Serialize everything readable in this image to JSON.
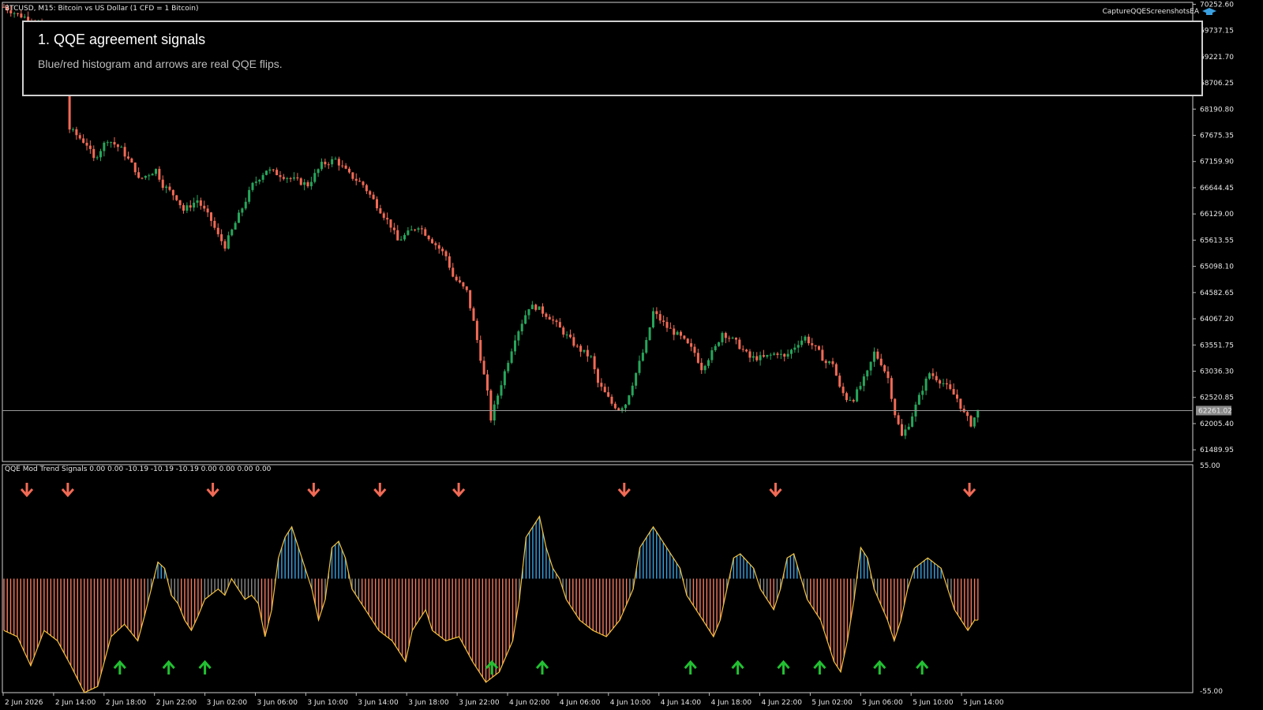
{
  "window": {
    "symbol_title": "BTCUSD, M15:  Bitcoin vs US Dollar (1 CFD = 1 Bitcoin)",
    "ea_label": "CaptureQQEScreenshotsEA",
    "ea_icon": "graduation-cap-icon"
  },
  "info_box": {
    "title": "1. QQE agreement signals",
    "subtitle": "Blue/red histogram and arrows are real QQE flips."
  },
  "indicator": {
    "title": "QQE Mod Trend Signals 0.00 0.00 -10.19 -10.19 -10.19 0.00 0.00 0.00 0.00",
    "axis_top": "55.00",
    "axis_bottom": "-55.00"
  },
  "colors": {
    "bull_candle": "#26a65b",
    "bear_candle": "#f26a55",
    "hist_bull": "#3aa0e0",
    "hist_bear": "#f27a60",
    "hist_neutral": "#8a8a8a",
    "qqe_line": "#f5c33b",
    "up_arrow": "#22c032",
    "down_arrow": "#f26a55",
    "price_line": "#9a9a9a",
    "current_price_bg": "#8a8a8a"
  },
  "chart_data": [
    {
      "type": "candlestick",
      "title": "BTCUSD, M15:  Bitcoin vs US Dollar (1 CFD = 1 Bitcoin)",
      "y_ticks": [
        "70252.60",
        "69737.15",
        "69221.70",
        "68706.25",
        "68190.80",
        "67675.35",
        "67159.90",
        "66644.45",
        "66129.00",
        "65613.55",
        "65098.10",
        "64582.65",
        "64067.20",
        "63551.75",
        "63036.30",
        "62520.85",
        "62005.40",
        "61489.95"
      ],
      "ylim": [
        61260,
        70290
      ],
      "current_price": "62261.02",
      "x_ticks": [
        "2 Jun 2026",
        "2 Jun 14:00",
        "2 Jun 18:00",
        "2 Jun 22:00",
        "3 Jun 02:00",
        "3 Jun 06:00",
        "3 Jun 10:00",
        "3 Jun 14:00",
        "3 Jun 18:00",
        "3 Jun 22:00",
        "4 Jun 02:00",
        "4 Jun 06:00",
        "4 Jun 10:00",
        "4 Jun 14:00",
        "4 Jun 18:00",
        "4 Jun 22:00",
        "5 Jun 02:00",
        "5 Jun 06:00",
        "5 Jun 10:00",
        "5 Jun 14:00"
      ],
      "close_path": [
        [
          0,
          70200
        ],
        [
          4,
          70050
        ],
        [
          10,
          69900
        ],
        [
          16,
          69400
        ],
        [
          18,
          68500
        ],
        [
          19,
          67800
        ],
        [
          24,
          67500
        ],
        [
          26,
          67200
        ],
        [
          30,
          67600
        ],
        [
          34,
          67400
        ],
        [
          38,
          67000
        ],
        [
          39,
          66800
        ],
        [
          44,
          67000
        ],
        [
          46,
          66700
        ],
        [
          50,
          66450
        ],
        [
          52,
          66200
        ],
        [
          56,
          66400
        ],
        [
          60,
          66000
        ],
        [
          62,
          65700
        ],
        [
          64,
          65500
        ],
        [
          68,
          66100
        ],
        [
          72,
          66700
        ],
        [
          76,
          67000
        ],
        [
          80,
          66900
        ],
        [
          84,
          66800
        ],
        [
          88,
          66700
        ],
        [
          92,
          67100
        ],
        [
          96,
          67200
        ],
        [
          100,
          66900
        ],
        [
          104,
          66700
        ],
        [
          108,
          66300
        ],
        [
          112,
          65900
        ],
        [
          114,
          65600
        ],
        [
          118,
          65800
        ],
        [
          120,
          65900
        ],
        [
          124,
          65600
        ],
        [
          128,
          65300
        ],
        [
          130,
          64900
        ],
        [
          134,
          64600
        ],
        [
          136,
          64000
        ],
        [
          138,
          63300
        ],
        [
          140,
          62600
        ],
        [
          141,
          62100
        ],
        [
          144,
          62800
        ],
        [
          148,
          63700
        ],
        [
          152,
          64300
        ],
        [
          154,
          64300
        ],
        [
          158,
          64100
        ],
        [
          162,
          63800
        ],
        [
          166,
          63500
        ],
        [
          170,
          63300
        ],
        [
          172,
          62800
        ],
        [
          176,
          62400
        ],
        [
          178,
          62300
        ],
        [
          180,
          62400
        ],
        [
          182,
          62800
        ],
        [
          186,
          63600
        ],
        [
          188,
          64200
        ],
        [
          192,
          63900
        ],
        [
          196,
          63700
        ],
        [
          200,
          63400
        ],
        [
          202,
          63100
        ],
        [
          206,
          63500
        ],
        [
          208,
          63800
        ],
        [
          212,
          63600
        ],
        [
          216,
          63300
        ],
        [
          220,
          63300
        ],
        [
          224,
          63400
        ],
        [
          226,
          63300
        ],
        [
          230,
          63600
        ],
        [
          232,
          63700
        ],
        [
          236,
          63400
        ],
        [
          238,
          63200
        ],
        [
          240,
          63200
        ],
        [
          242,
          62700
        ],
        [
          244,
          62500
        ],
        [
          246,
          62500
        ],
        [
          250,
          63000
        ],
        [
          252,
          63400
        ],
        [
          254,
          63200
        ],
        [
          256,
          62900
        ],
        [
          258,
          62200
        ],
        [
          260,
          61750
        ],
        [
          262,
          62000
        ],
        [
          266,
          62700
        ],
        [
          268,
          63000
        ],
        [
          272,
          62800
        ],
        [
          276,
          62500
        ],
        [
          278,
          62200
        ],
        [
          280,
          62000
        ],
        [
          282,
          62250
        ]
      ]
    },
    {
      "type": "histogram_with_line",
      "title": "QQE Mod Trend Signals 0.00 0.00 -10.19 -10.19 -10.19 0.00 0.00 0.00 0.00",
      "ylim": [
        -55,
        55
      ],
      "values_path": [
        [
          0,
          -25
        ],
        [
          4,
          -28
        ],
        [
          8,
          -42
        ],
        [
          12,
          -25
        ],
        [
          16,
          -30
        ],
        [
          20,
          -42
        ],
        [
          24,
          -55
        ],
        [
          28,
          -52
        ],
        [
          32,
          -28
        ],
        [
          36,
          -22
        ],
        [
          40,
          -30
        ],
        [
          42,
          -18
        ],
        [
          44,
          -5
        ],
        [
          46,
          8
        ],
        [
          48,
          5
        ],
        [
          50,
          -8
        ],
        [
          52,
          -12
        ],
        [
          54,
          -20
        ],
        [
          56,
          -25
        ],
        [
          58,
          -18
        ],
        [
          60,
          -10
        ],
        [
          64,
          -5
        ],
        [
          66,
          -8
        ],
        [
          68,
          0
        ],
        [
          70,
          -5
        ],
        [
          72,
          -10
        ],
        [
          74,
          -8
        ],
        [
          76,
          -12
        ],
        [
          78,
          -28
        ],
        [
          80,
          -15
        ],
        [
          82,
          10
        ],
        [
          84,
          20
        ],
        [
          86,
          25
        ],
        [
          88,
          15
        ],
        [
          90,
          5
        ],
        [
          92,
          -5
        ],
        [
          94,
          -20
        ],
        [
          96,
          -10
        ],
        [
          98,
          15
        ],
        [
          100,
          18
        ],
        [
          102,
          10
        ],
        [
          104,
          -5
        ],
        [
          108,
          -15
        ],
        [
          110,
          -20
        ],
        [
          112,
          -25
        ],
        [
          116,
          -30
        ],
        [
          120,
          -40
        ],
        [
          122,
          -25
        ],
        [
          126,
          -15
        ],
        [
          128,
          -25
        ],
        [
          132,
          -30
        ],
        [
          136,
          -28
        ],
        [
          140,
          -40
        ],
        [
          144,
          -50
        ],
        [
          148,
          -45
        ],
        [
          152,
          -30
        ],
        [
          154,
          -10
        ],
        [
          156,
          20
        ],
        [
          160,
          30
        ],
        [
          162,
          15
        ],
        [
          164,
          5
        ],
        [
          166,
          0
        ],
        [
          168,
          -10
        ],
        [
          172,
          -20
        ],
        [
          176,
          -25
        ],
        [
          180,
          -28
        ],
        [
          184,
          -20
        ],
        [
          188,
          -5
        ],
        [
          190,
          15
        ],
        [
          194,
          25
        ],
        [
          198,
          15
        ],
        [
          202,
          5
        ],
        [
          204,
          -8
        ],
        [
          208,
          -18
        ],
        [
          212,
          -28
        ],
        [
          214,
          -20
        ],
        [
          216,
          -5
        ],
        [
          218,
          10
        ],
        [
          220,
          12
        ],
        [
          224,
          5
        ],
        [
          226,
          -5
        ],
        [
          228,
          -10
        ],
        [
          230,
          -15
        ],
        [
          232,
          -5
        ],
        [
          234,
          10
        ],
        [
          236,
          12
        ],
        [
          240,
          -10
        ],
        [
          244,
          -20
        ],
        [
          248,
          -40
        ],
        [
          250,
          -45
        ],
        [
          252,
          -30
        ],
        [
          254,
          -10
        ],
        [
          256,
          15
        ],
        [
          258,
          10
        ],
        [
          260,
          -5
        ],
        [
          264,
          -20
        ],
        [
          266,
          -30
        ],
        [
          268,
          -20
        ],
        [
          270,
          -5
        ],
        [
          272,
          5
        ],
        [
          276,
          10
        ],
        [
          280,
          5
        ],
        [
          284,
          -15
        ],
        [
          288,
          -25
        ],
        [
          290,
          -20
        ]
      ],
      "down_arrows_at_x": [
        "2 Jun 2026",
        "2 Jun 14:00",
        "3 Jun 02:00",
        "3 Jun 10:00",
        "3 Jun 14:00",
        "3 Jun 22:00",
        "4 Jun 10:00",
        "4 Jun 22:00",
        "5 Jun 14:00"
      ],
      "up_arrows_at_x": [
        "2 Jun 18:00",
        "2 Jun 22:00",
        "3 Jun 02:00",
        "3 Jun 22:00",
        "4 Jun 02:00",
        "4 Jun 14:00",
        "4 Jun 18:00",
        "4 Jun 22:00",
        "5 Jun 02:00",
        "5 Jun 06:00",
        "5 Jun 10:00"
      ]
    }
  ]
}
